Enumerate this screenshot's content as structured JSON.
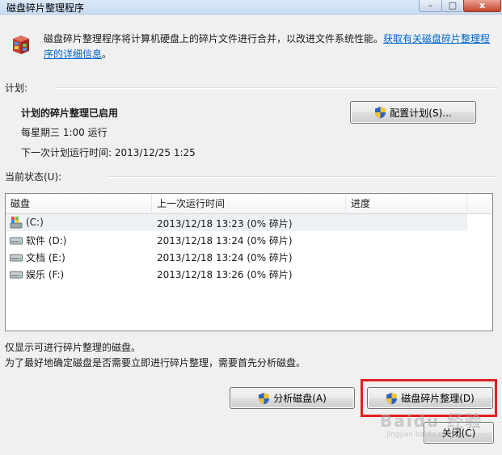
{
  "window": {
    "title": "磁盘碎片整理程序",
    "controls": {
      "minimize": "–",
      "maximize": "□",
      "close": "x"
    }
  },
  "intro": {
    "text": "磁盘碎片整理程序将计算机硬盘上的碎片文件进行合并，以改进文件系统性能。",
    "link_line1": "获取有关磁盘碎片整理程",
    "link_line2": "序的详细信息",
    "suffix": "。"
  },
  "schedule": {
    "section_label": "计划:",
    "status": "计划的碎片整理已启用",
    "frequency": "每星期三 1:00 运行",
    "next_run": "下一次计划运行时间: 2013/12/25 1:25",
    "configure_button": "配置计划(S)..."
  },
  "current_status": {
    "section_label": "当前状态(U):",
    "columns": [
      "磁盘",
      "上一次运行时间",
      "进度"
    ],
    "rows": [
      {
        "icon": "system-drive-icon",
        "disk": "(C:)",
        "last_run": "2013/12/18 13:23 (0% 碎片)",
        "progress": ""
      },
      {
        "icon": "hard-drive-icon",
        "disk": "软件 (D:)",
        "last_run": "2013/12/18 13:24 (0% 碎片)",
        "progress": ""
      },
      {
        "icon": "hard-drive-icon",
        "disk": "文档 (E:)",
        "last_run": "2013/12/18 13:24 (0% 碎片)",
        "progress": ""
      },
      {
        "icon": "hard-drive-icon",
        "disk": "娱乐 (F:)",
        "last_run": "2013/12/18 13:26 (0% 碎片)",
        "progress": ""
      }
    ]
  },
  "notes": {
    "line1": "仅显示可进行碎片整理的磁盘。",
    "line2": "为了最好地确定磁盘是否需要立即进行碎片整理，需要首先分析磁盘。"
  },
  "actions": {
    "analyze_button": "分析磁盘(A)",
    "defrag_button": "磁盘碎片整理(D)",
    "close_button": "关闭(C)"
  },
  "watermark": {
    "text": "Baidu 经验",
    "sub": "jingyan.baidu.com"
  },
  "colors": {
    "highlight": "#e02020",
    "link": "#0066cc"
  }
}
